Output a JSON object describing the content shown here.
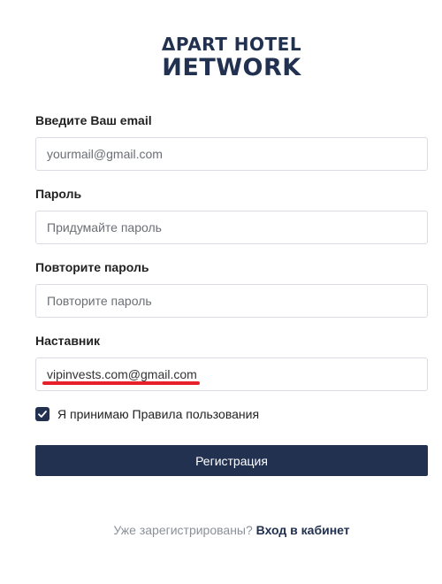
{
  "logo": {
    "line1": "ΔPART HOTEL",
    "line2": "ИETWORK"
  },
  "form": {
    "email": {
      "label": "Введите Ваш email",
      "placeholder": "yourmail@gmail.com",
      "value": ""
    },
    "password": {
      "label": "Пароль",
      "placeholder": "Придумайте пароль",
      "value": ""
    },
    "password_repeat": {
      "label": "Повторите пароль",
      "placeholder": "Повторите пароль",
      "value": ""
    },
    "mentor": {
      "label": "Наставник",
      "placeholder": "",
      "value": "vipinvests.com@gmail.com"
    },
    "terms": {
      "checked": true,
      "label": "Я принимаю Правила пользования"
    },
    "submit_label": "Регистрация"
  },
  "footer": {
    "question": "Уже зарегистрированы?",
    "login_link": "Вход в кабинет"
  },
  "colors": {
    "brand": "#21314f",
    "highlight": "#e8202a",
    "muted_text": "#8a9099"
  }
}
